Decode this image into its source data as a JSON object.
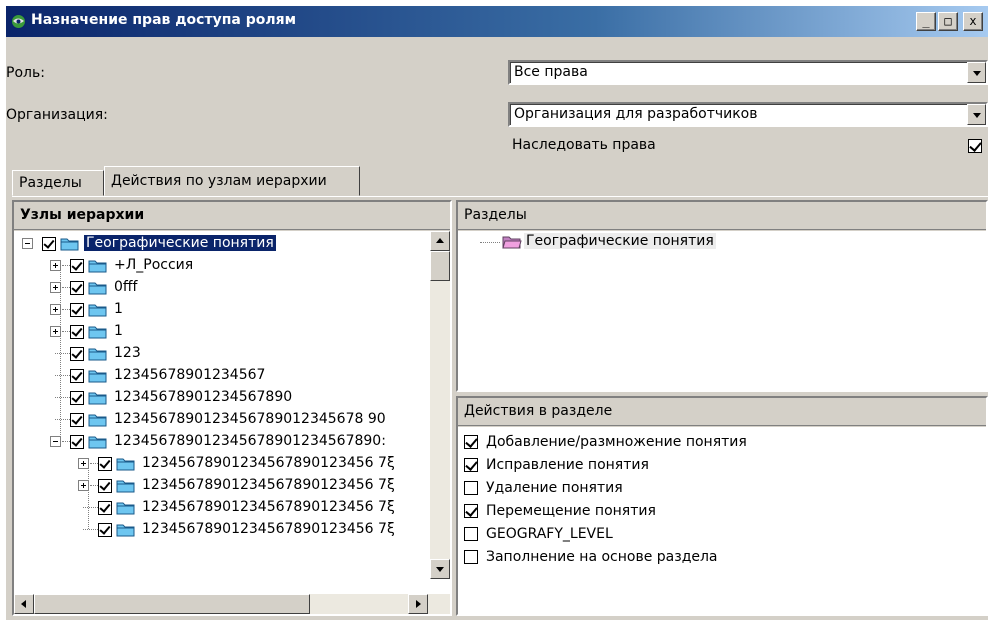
{
  "window": {
    "title": "Назначение прав доступа ролям",
    "buttons": {
      "minimize": "_",
      "maximize": "□",
      "close": "x"
    }
  },
  "form": {
    "role_label": "Роль:",
    "role_value": "Все права",
    "org_label": "Организация:",
    "org_value": "Организация для разработчиков",
    "inherit_label": "Наследовать права",
    "inherit_checked": true
  },
  "tabs": [
    {
      "label": "Разделы",
      "active": false
    },
    {
      "label": "Действия по узлам иерархии",
      "active": true
    }
  ],
  "hierarchy_panel": {
    "header": "Узлы иерархии",
    "nodes": [
      {
        "label": "Географические понятия",
        "level": 0,
        "expander": "minus",
        "checked": true,
        "selected": true
      },
      {
        "label": "+Л_Россия",
        "level": 1,
        "expander": "plus",
        "checked": true,
        "selected": false
      },
      {
        "label": "0fff",
        "level": 1,
        "expander": "plus",
        "checked": true,
        "selected": false
      },
      {
        "label": "1",
        "level": 1,
        "expander": "plus",
        "checked": true,
        "selected": false
      },
      {
        "label": "1",
        "level": 1,
        "expander": "plus",
        "checked": true,
        "selected": false
      },
      {
        "label": "123",
        "level": 1,
        "expander": "none",
        "checked": true,
        "selected": false
      },
      {
        "label": "12345678901234567",
        "level": 1,
        "expander": "none",
        "checked": true,
        "selected": false
      },
      {
        "label": "1234567890123456789​0",
        "level": 1,
        "expander": "none",
        "checked": true,
        "selected": false
      },
      {
        "label": "1234567890123456789012345678 90",
        "level": 1,
        "expander": "none",
        "checked": true,
        "selected": false
      },
      {
        "label": "123456789012345678901234567890:",
        "level": 1,
        "expander": "minus",
        "checked": true,
        "selected": false
      },
      {
        "label": "12345678901234567890123456 7ξ",
        "level": 2,
        "expander": "plus",
        "checked": true,
        "selected": false
      },
      {
        "label": "12345678901234567890123456 7ξ",
        "level": 2,
        "expander": "plus",
        "checked": true,
        "selected": false
      },
      {
        "label": "12345678901234567890123456 7ξ",
        "level": 2,
        "expander": "none",
        "checked": true,
        "selected": false
      },
      {
        "label": "12345678901234567890123456 7ξ",
        "level": 2,
        "expander": "none",
        "checked": true,
        "selected": false
      }
    ]
  },
  "sections_panel": {
    "header": "Разделы",
    "items": [
      {
        "label": "Географические понятия"
      }
    ]
  },
  "actions_panel": {
    "header": "Действия в разделе",
    "items": [
      {
        "label": "Добавление/размножение понятия",
        "checked": true
      },
      {
        "label": "Исправление понятия",
        "checked": true
      },
      {
        "label": "Удаление понятия",
        "checked": false
      },
      {
        "label": "Перемещение понятия",
        "checked": true
      },
      {
        "label": "GEOGRAFY_LEVEL",
        "checked": false
      },
      {
        "label": "Заполнение на основе раздела",
        "checked": false
      }
    ]
  },
  "colors": {
    "titlebar_start": "#0a246a",
    "titlebar_end": "#a6caf0",
    "window_bg": "#d4d0c8",
    "selection_bg": "#0a246a",
    "folder_fill": "#6ec6f0",
    "folder_fill_pink": "#f0a0e0"
  }
}
